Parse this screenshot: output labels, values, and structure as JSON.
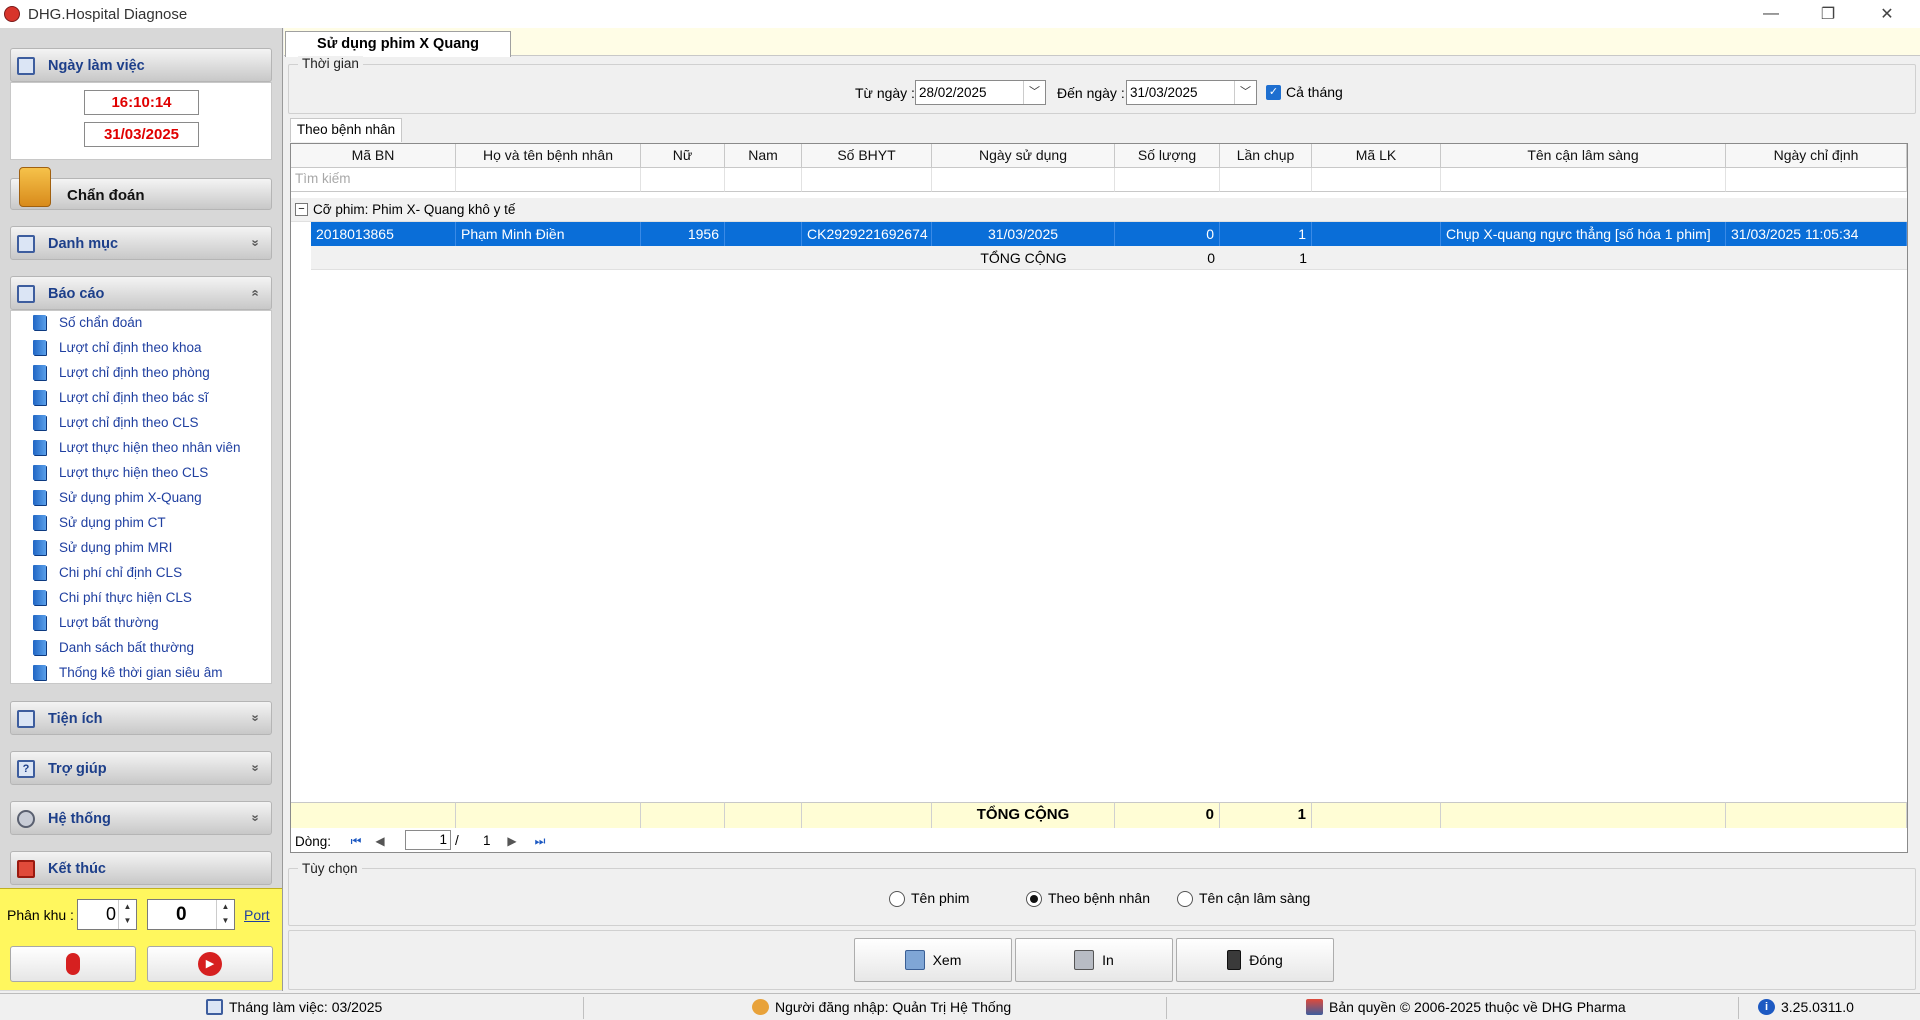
{
  "window": {
    "title": "DHG.Hospital Diagnose",
    "minimize": "—",
    "restore": "❐",
    "close": "✕"
  },
  "sidebar": {
    "working_day": {
      "title": "Ngày làm việc",
      "time": "16:10:14",
      "date": "31/03/2025"
    },
    "diagnose": {
      "title": "Chẩn đoán"
    },
    "catalog": {
      "title": "Danh mục",
      "chevron": "»"
    },
    "reports": {
      "title": "Báo cáo",
      "chevron": "«",
      "items": [
        "Số chẩn đoán",
        "Lượt chỉ định theo khoa",
        "Lượt chỉ định theo phòng",
        "Lượt chỉ định theo bác sĩ",
        "Lượt chỉ định theo CLS",
        "Lượt thực hiện theo nhân viên",
        "Lượt thực hiện theo CLS",
        "Sử dụng phim X-Quang",
        "Sử dụng phim CT",
        "Sử dụng phim MRI",
        "Chi phí chỉ định CLS",
        "Chi phí thực hiện CLS",
        "Lượt bất thường",
        "Danh sách bất thường",
        "Thống kê thời gian siêu âm"
      ]
    },
    "utilities": {
      "title": "Tiện ích",
      "chevron": "»"
    },
    "help": {
      "title": "Trợ giúp",
      "chevron": "»"
    },
    "system": {
      "title": "Hệ thống",
      "chevron": "»"
    },
    "exit": {
      "title": "Kết thúc"
    },
    "zone": {
      "label": "Phân khu :",
      "value1": "0",
      "value2": "0",
      "port": "Port"
    }
  },
  "main": {
    "tab": "Sử dụng phim X Quang",
    "time_group": {
      "label": "Thời gian",
      "from_label": "Từ ngày :",
      "from_value": "28/02/2025",
      "to_label": "Đến ngày :",
      "to_value": "31/03/2025",
      "whole_month": "Cả tháng"
    },
    "subtab": "Theo bệnh nhân",
    "grid": {
      "columns": [
        "Mã BN",
        "Họ và tên bệnh nhân",
        "Nữ",
        "Nam",
        "Số BHYT",
        "Ngày sử dụng",
        "Số lượng",
        "Lần chụp",
        "Mã LK",
        "Tên cận lâm sàng",
        "Ngày chỉ định"
      ],
      "search_placeholder": "Tìm kiếm",
      "group_toggle": "−",
      "group_label": "Cỡ phim:  Phim X- Quang khô y tế",
      "rows": [
        {
          "ma_bn": "2018013865",
          "ho_ten": "Phạm Minh Điền",
          "nu": "1956",
          "nam": "",
          "bhyt": "CK2929221692674",
          "ngay_su_dung": "31/03/2025",
          "so_luong": "0",
          "lan_chup": "1",
          "ma_lk": "",
          "ten_cls": "Chụp X-quang ngực thẳng [số hóa 1 phim]",
          "ngay_chi_dinh": "31/03/2025 11:05:34"
        }
      ],
      "group_total": {
        "label": "TỔNG CỘNG",
        "so_luong": "0",
        "lan_chup": "1"
      },
      "footer_total": {
        "label": "TỔNG CỘNG",
        "so_luong": "0",
        "lan_chup": "1"
      }
    },
    "pager": {
      "label": "Dòng:",
      "current": "1",
      "separator": "/",
      "total": "1"
    },
    "options": {
      "label": "Tùy chọn",
      "opt1": "Tên phim",
      "opt2": "Theo bệnh nhân",
      "opt3": "Tên cận lâm sàng",
      "selected": "Theo bệnh nhân"
    },
    "buttons": {
      "view": "Xem",
      "print": "In",
      "close": "Đóng"
    }
  },
  "status": {
    "month": "Tháng làm việc: 03/2025",
    "user": "Người đăng nhập: Quản Trị Hệ Thống",
    "copyright": "Bản quyền © 2006-2025 thuộc về DHG Pharma",
    "version": "3.25.0311.0"
  }
}
